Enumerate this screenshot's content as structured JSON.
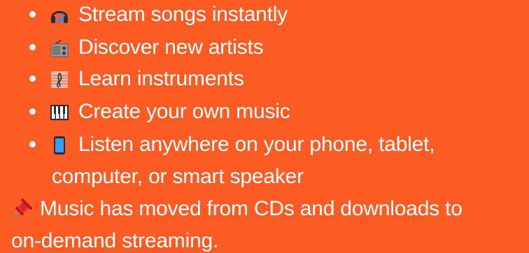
{
  "features": [
    {
      "icon": "headphones-icon",
      "text": "Stream songs instantly"
    },
    {
      "icon": "radio-icon",
      "text": "Discover new artists"
    },
    {
      "icon": "musical-score-icon",
      "text": "Learn instruments"
    },
    {
      "icon": "piano-keys-icon",
      "text": "Create your own music"
    },
    {
      "icon": "mobile-phone-icon",
      "text": "Listen anywhere on your phone, tablet,",
      "continuation": "computer, or smart speaker"
    }
  ],
  "note": {
    "icon": "pushpin-icon",
    "line1": "Music has moved from CDs and downloads to",
    "line2": "on-demand streaming."
  },
  "colors": {
    "background": "#fd5b24",
    "text": "#ffffff"
  }
}
